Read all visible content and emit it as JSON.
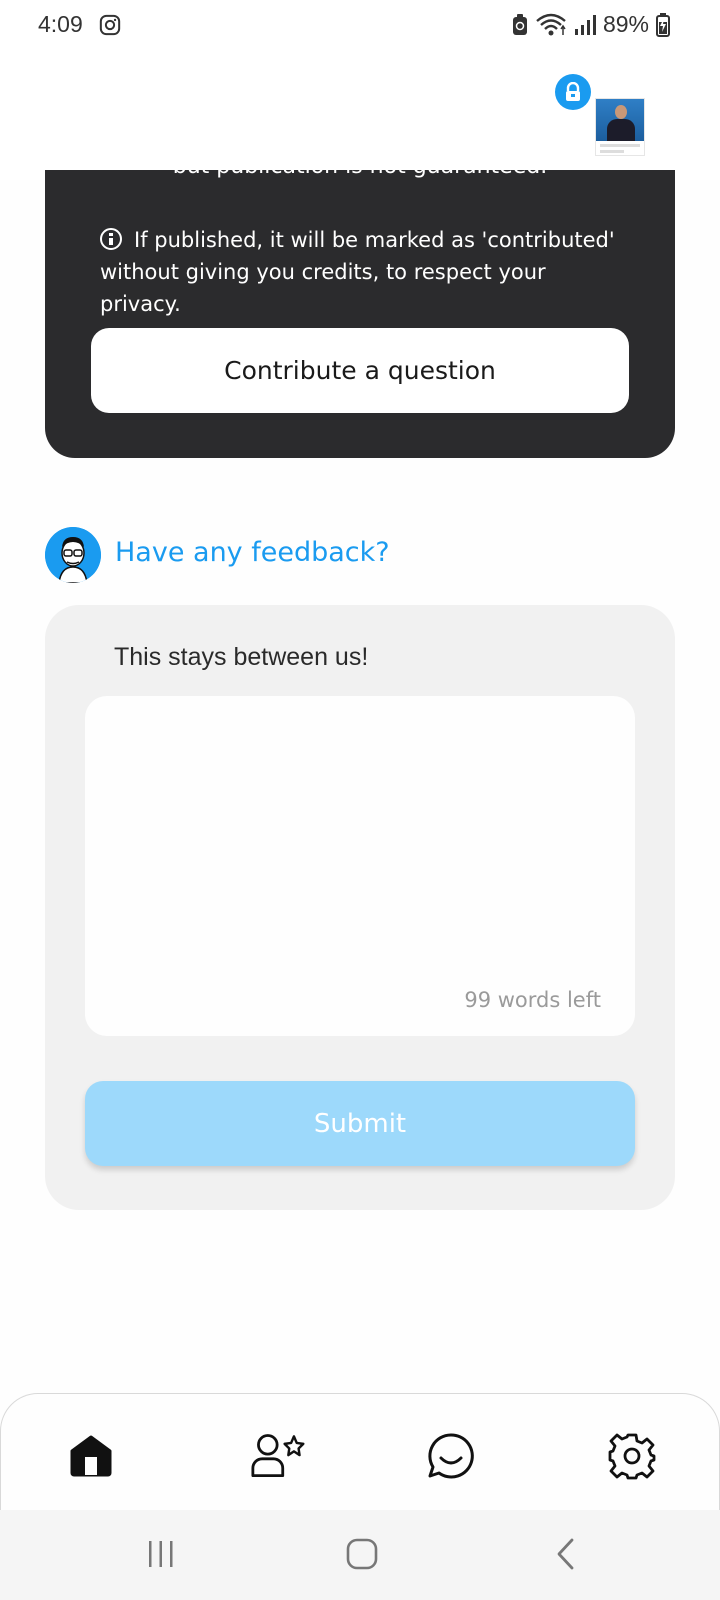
{
  "status_bar": {
    "time": "4:09",
    "battery": "89%",
    "icons": [
      "instagram-icon",
      "recycle-icon",
      "wifi-icon",
      "signal-icon",
      "battery-charging-icon"
    ]
  },
  "header": {
    "lock_icon": "lock-icon",
    "thumbnail": "profile-thumbnail"
  },
  "contribute": {
    "partial_text": "but publication is not guaranteed.",
    "info_text": "If published, it will be marked as 'contributed' without giving you credits, to respect your privacy.",
    "button_label": "Contribute a question"
  },
  "feedback": {
    "title": "Have any feedback?",
    "subtitle": "This stays between us!",
    "input_value": "",
    "words_left": "99 words left",
    "submit_label": "Submit"
  },
  "bottom_nav": {
    "items": [
      "home-icon",
      "people-star-icon",
      "chat-icon",
      "gear-icon"
    ]
  },
  "system_nav": {
    "items": [
      "recent-apps-icon",
      "home-circle-icon",
      "back-icon"
    ]
  },
  "colors": {
    "accent": "#1a9bf0",
    "dark_card": "#2b2b2d",
    "submit_disabled": "#9dd9fb",
    "card_bg": "#f1f1f1"
  }
}
